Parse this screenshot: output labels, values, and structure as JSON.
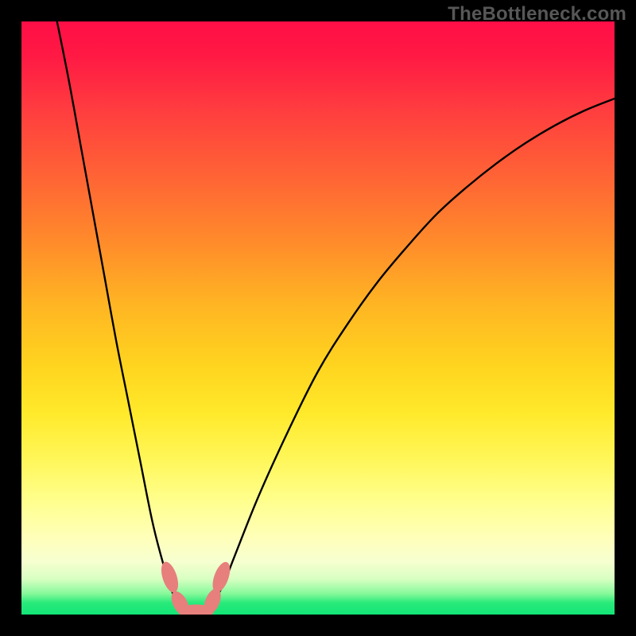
{
  "watermark": "TheBottleneck.com",
  "chart_data": {
    "type": "line",
    "title": "",
    "xlabel": "",
    "ylabel": "",
    "xlim": [
      0,
      100
    ],
    "ylim": [
      0,
      100
    ],
    "grid": false,
    "legend": false,
    "background_gradient": {
      "orientation": "vertical",
      "stops": [
        {
          "pos": 0,
          "color": "#ff0e46"
        },
        {
          "pos": 50,
          "color": "#ffd41f"
        },
        {
          "pos": 90,
          "color": "#ffffc0"
        },
        {
          "pos": 100,
          "color": "#12e576"
        }
      ]
    },
    "series": [
      {
        "name": "curve-left",
        "x": [
          6,
          8,
          10,
          12,
          14,
          16,
          18,
          20,
          22,
          23.5,
          25,
          26,
          27,
          28
        ],
        "y": [
          100,
          90,
          79,
          68,
          57,
          46,
          36,
          26,
          16,
          10,
          5,
          2.5,
          1,
          0.4
        ],
        "color": "#000000"
      },
      {
        "name": "curve-right",
        "x": [
          31,
          32,
          34,
          36,
          40,
          45,
          50,
          55,
          60,
          65,
          70,
          75,
          80,
          85,
          90,
          95,
          100
        ],
        "y": [
          0.4,
          1.5,
          5,
          10,
          20,
          31,
          41,
          49,
          56,
          62,
          67.5,
          72,
          76,
          79.5,
          82.5,
          85,
          87
        ],
        "color": "#000000"
      }
    ],
    "markers": [
      {
        "name": "marker-left-upper",
        "cx": 25.0,
        "cy": 6.3,
        "rx": 1.2,
        "ry": 2.7,
        "rotate": -18,
        "color": "#e77f7d"
      },
      {
        "name": "marker-left-lower",
        "cx": 26.8,
        "cy": 1.8,
        "rx": 1.2,
        "ry": 2.3,
        "rotate": -28,
        "color": "#e77f7d"
      },
      {
        "name": "marker-bottom",
        "cx": 29.5,
        "cy": 0.5,
        "rx": 2.9,
        "ry": 1.2,
        "rotate": 0,
        "color": "#e77f7d"
      },
      {
        "name": "marker-right-lower",
        "cx": 32.2,
        "cy": 2.2,
        "rx": 1.2,
        "ry": 2.3,
        "rotate": 22,
        "color": "#e77f7d"
      },
      {
        "name": "marker-right-upper",
        "cx": 33.7,
        "cy": 6.3,
        "rx": 1.2,
        "ry": 2.7,
        "rotate": 20,
        "color": "#e77f7d"
      }
    ]
  }
}
